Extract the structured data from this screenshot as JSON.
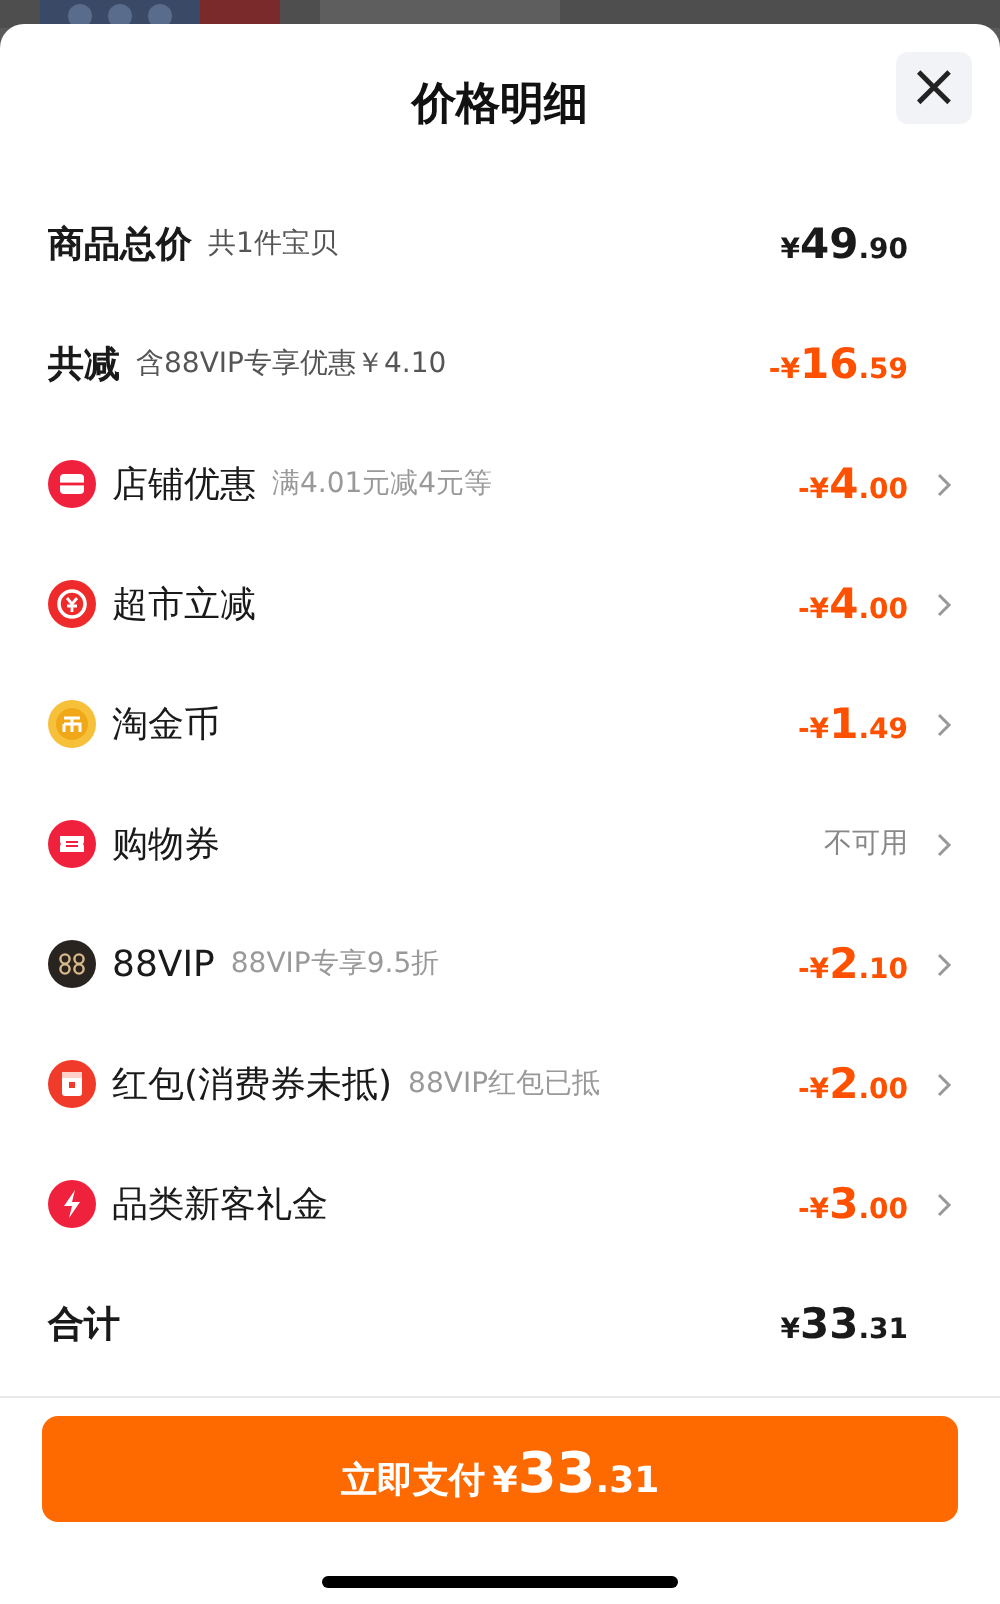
{
  "sheet": {
    "title": "价格明细",
    "close": "×"
  },
  "rows": [
    {
      "kind": "summary",
      "label": "商品总价",
      "note": "共1件宝贝",
      "value": "¥49.90",
      "discount": false,
      "available": true
    },
    {
      "kind": "summary",
      "label": "共减",
      "note": "含88VIP专享优惠￥4.10",
      "value": "-¥16.59",
      "discount": true,
      "available": true
    },
    {
      "kind": "item",
      "label": "店铺优惠",
      "note": "满4.01元减4元等",
      "value": "-¥4.00",
      "discount": true,
      "available": true
    },
    {
      "kind": "item",
      "label": "超市立减",
      "value": "-¥4.00",
      "discount": true,
      "available": true
    },
    {
      "kind": "item",
      "label": "淘金币",
      "value": "-¥1.49",
      "discount": true,
      "available": true
    },
    {
      "kind": "item",
      "label": "购物券",
      "value": "不可用",
      "discount": false,
      "available": false
    },
    {
      "kind": "item",
      "label": "88VIP",
      "note": "88VIP专享9.5折",
      "value": "-¥2.10",
      "discount": true,
      "available": true
    },
    {
      "kind": "item",
      "label": "红包(消费券未抵)",
      "note": "88VIP红包已抵",
      "value": "-¥2.00",
      "discount": true,
      "available": true
    },
    {
      "kind": "item",
      "label": "品类新客礼金",
      "value": "-¥3.00",
      "discount": true,
      "available": true
    },
    {
      "kind": "summary",
      "label": "合计",
      "value": "¥33.31",
      "discount": false,
      "available": true
    }
  ],
  "pay_button": {
    "label": "立即支付",
    "amount": "¥33.31"
  }
}
